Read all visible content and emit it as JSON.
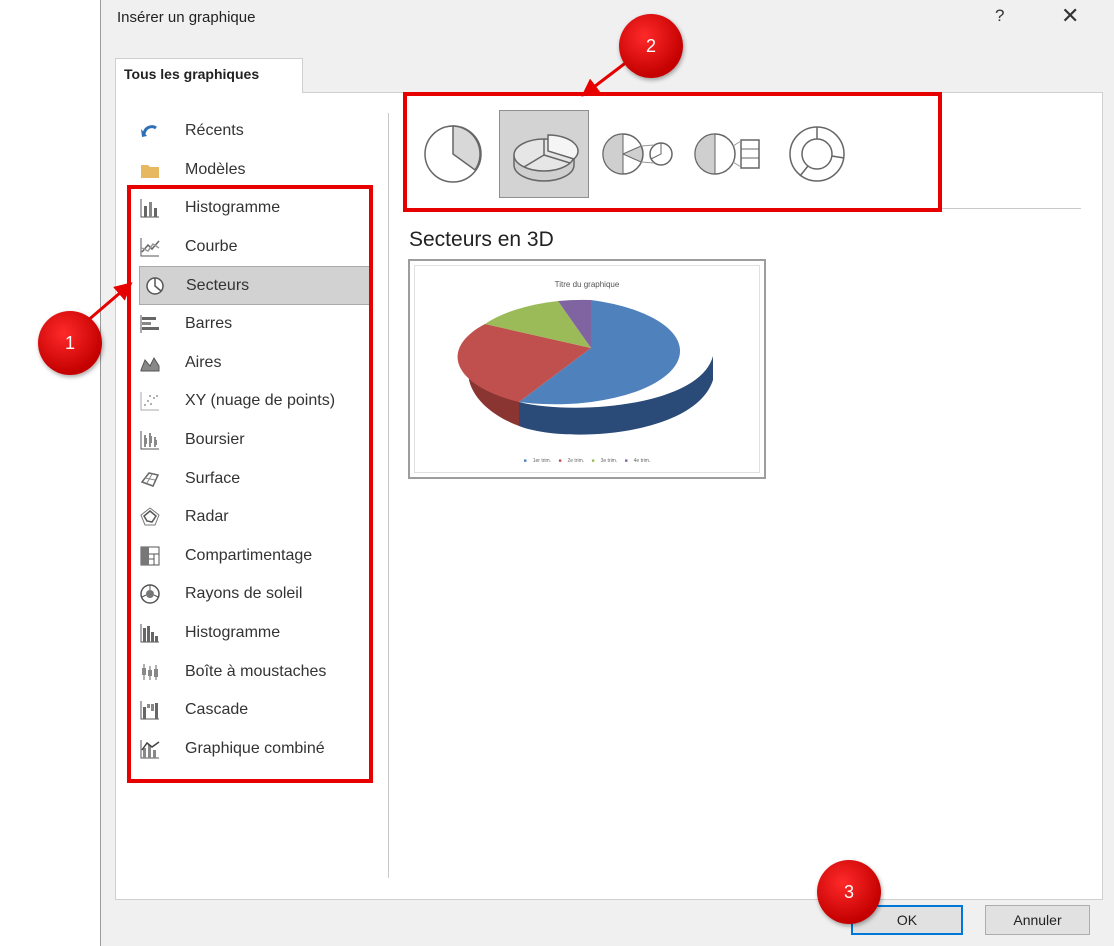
{
  "dialog": {
    "title": "Insérer un graphique",
    "help_label": "?",
    "close_label": "✕",
    "tab": "Tous les graphiques"
  },
  "categories": [
    {
      "label": "Récents",
      "icon": "undo-arrow-icon"
    },
    {
      "label": "Modèles",
      "icon": "folder-icon"
    },
    {
      "label": "Histogramme",
      "icon": "column-chart-icon"
    },
    {
      "label": "Courbe",
      "icon": "line-chart-icon"
    },
    {
      "label": "Secteurs",
      "icon": "pie-chart-icon",
      "selected": true
    },
    {
      "label": "Barres",
      "icon": "bar-chart-icon"
    },
    {
      "label": "Aires",
      "icon": "area-chart-icon"
    },
    {
      "label": "XY (nuage de points)",
      "icon": "scatter-chart-icon"
    },
    {
      "label": "Boursier",
      "icon": "stock-chart-icon"
    },
    {
      "label": "Surface",
      "icon": "surface-chart-icon"
    },
    {
      "label": "Radar",
      "icon": "radar-chart-icon"
    },
    {
      "label": "Compartimentage",
      "icon": "treemap-chart-icon"
    },
    {
      "label": "Rayons de soleil",
      "icon": "sunburst-chart-icon"
    },
    {
      "label": "Histogramme",
      "icon": "histogram-chart-icon"
    },
    {
      "label": "Boîte à moustaches",
      "icon": "box-whisker-chart-icon"
    },
    {
      "label": "Cascade",
      "icon": "waterfall-chart-icon"
    },
    {
      "label": "Graphique combiné",
      "icon": "combo-chart-icon"
    }
  ],
  "subtypes": [
    {
      "icon": "pie-subtype-icon"
    },
    {
      "icon": "pie-3d-subtype-icon",
      "selected": true
    },
    {
      "icon": "pie-of-pie-subtype-icon"
    },
    {
      "icon": "bar-of-pie-subtype-icon"
    },
    {
      "icon": "doughnut-subtype-icon"
    }
  ],
  "selected_subtype_name": "Secteurs en 3D",
  "preview": {
    "title": "Titre du graphique",
    "legend": [
      "1er trim.",
      "2e trim.",
      "3e trim.",
      "4e trim."
    ],
    "colors": [
      "#4f81bd",
      "#c0504d",
      "#9bbb59",
      "#8064a2"
    ]
  },
  "buttons": {
    "ok": "OK",
    "cancel": "Annuler"
  },
  "annotations": {
    "one": "1",
    "two": "2",
    "three": "3",
    "color": "#e60000"
  }
}
